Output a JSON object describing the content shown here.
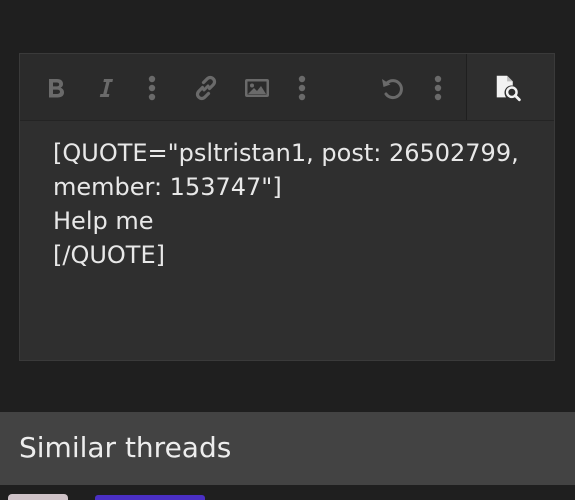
{
  "editor": {
    "toolbar": {
      "icons": [
        "bold-icon",
        "italic-icon",
        "more-icon",
        "link-icon",
        "image-icon",
        "more-icon",
        "undo-icon",
        "more-icon",
        "preview-icon"
      ]
    },
    "content_lines": [
      "[QUOTE=\"psltristan1, post: 26502799,",
      "member: 153747\"]",
      "Help me",
      "[/QUOTE]"
    ]
  },
  "similar_threads": {
    "title": "Similar threads"
  },
  "colors": {
    "background": "#1f1f1f",
    "editor_bg": "#2f2f2f",
    "toolbar_icon": "#6a6a6a",
    "preview_icon": "#f2f2f2",
    "section_header_bg": "#434343",
    "text": "#e8e8e8"
  }
}
